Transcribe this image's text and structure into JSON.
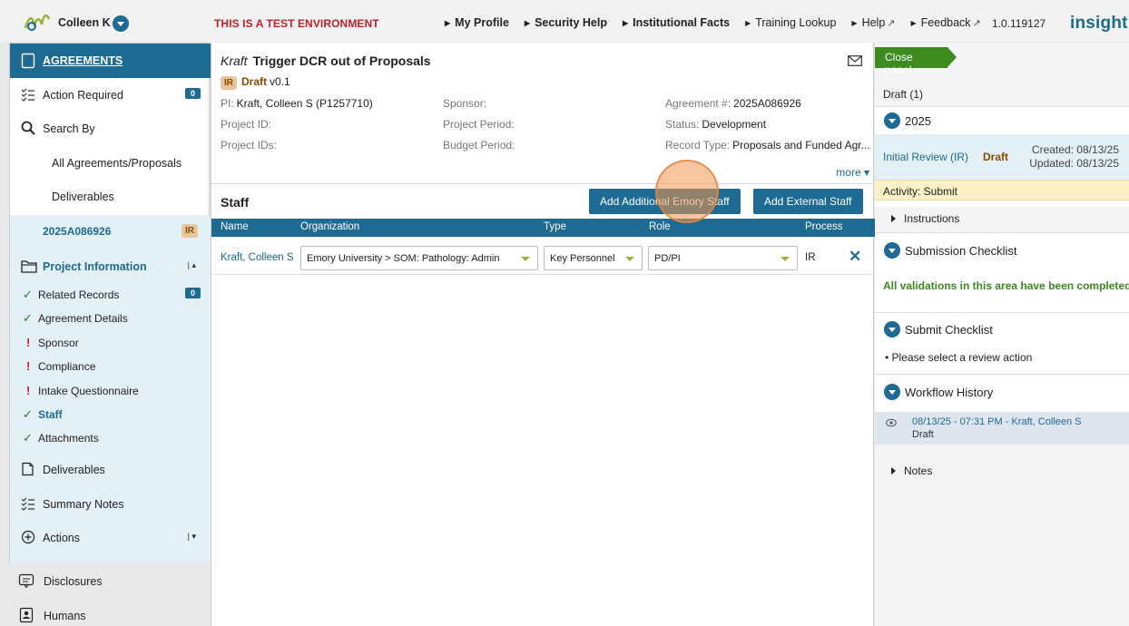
{
  "topbar": {
    "user_name": "Colleen K",
    "test_env": "THIS IS A TEST ENVIRONMENT",
    "nav": [
      {
        "label": "My Profile",
        "bold": true
      },
      {
        "label": "Security Help",
        "bold": true
      },
      {
        "label": "Institutional Facts",
        "bold": true
      },
      {
        "label": "Training Lookup",
        "bold": false
      },
      {
        "label": "Help",
        "bold": false
      },
      {
        "label": "Feedback",
        "bold": false
      }
    ],
    "version": "1.0.119127",
    "brand": "insight"
  },
  "leftnav": {
    "agreements": "AGREEMENTS",
    "action_required": "Action Required",
    "action_required_count": "0",
    "search_by": "Search By",
    "all_agreements": "All Agreements/Proposals",
    "deliverables": "Deliverables",
    "record_id": "2025A086926",
    "record_badge": "IR",
    "project_information": "Project Information",
    "project_info_caret": "| ▴",
    "sections": [
      {
        "label": "Related Records",
        "status": "ok",
        "badge": "0"
      },
      {
        "label": "Agreement Details",
        "status": "ok"
      },
      {
        "label": "Sponsor",
        "status": "bad"
      },
      {
        "label": "Compliance",
        "status": "bad"
      },
      {
        "label": "Intake Questionnaire",
        "status": "bad"
      },
      {
        "label": "Staff",
        "status": "ok",
        "active": true
      },
      {
        "label": "Attachments",
        "status": "ok"
      }
    ],
    "deliverables2": "Deliverables",
    "summary_notes": "Summary Notes",
    "actions": "Actions",
    "actions_caret": "| ▾",
    "disclosures": "Disclosures",
    "humans": "Humans"
  },
  "main": {
    "title_italic": "Kraft",
    "title": "Trigger DCR out of Proposals",
    "status_badge": "IR",
    "status_text": "Draft",
    "version": "v0.1",
    "fields": {
      "pi_k": "PI:",
      "pi_v": "Kraft, Colleen S (P1257710)",
      "sponsor_k": "Sponsor:",
      "sponsor_v": "",
      "agreement_k": "Agreement #:",
      "agreement_v": "2025A086926",
      "projid_k": "Project ID:",
      "projid_v": "",
      "period_k": "Project Period:",
      "period_v": "",
      "status_k": "Status:",
      "status_v": "Development",
      "projids_k": "Project IDs:",
      "projids_v": "",
      "budget_k": "Budget Period:",
      "budget_v": "",
      "rectype_k": "Record Type:",
      "rectype_v": "Proposals and Funded Agr..."
    },
    "more": "more ▾",
    "staff_title": "Staff",
    "btn_add_emory": "Add Additional Emory Staff",
    "btn_add_external": "Add External Staff",
    "columns": [
      "Name",
      "Organization",
      "Type",
      "Role",
      "Process"
    ],
    "row": {
      "name": "Kraft, Colleen S",
      "organization": "Emory University > SOM: Pathology: Admin",
      "type": "Key Personnel",
      "role": "PD/PI",
      "process": "IR",
      "remove": "✕"
    }
  },
  "right": {
    "close_panel": "Close panel",
    "draft_count": "Draft (1)",
    "year": "2025",
    "review_link": "Initial Review (IR)",
    "review_status": "Draft",
    "created": "Created: 08/13/25",
    "updated": "Updated: 08/13/25",
    "activity": "Activity:  Submit",
    "instructions": "Instructions",
    "submission_checklist": "Submission Checklist",
    "validations": "All validations in this area have been completed",
    "submit_checklist": "Submit Checklist",
    "submit_item": "Please select a review action",
    "workflow_history": "Workflow History",
    "history_entry": "08/13/25 - 07:31 PM",
    "history_user": "Kraft, Colleen S",
    "history_sep": " - ",
    "history_status": "Draft",
    "notes": "Notes"
  },
  "colors": {
    "primary": "#1d6a92",
    "success": "#3d8b1f",
    "danger": "#c0202a",
    "badge_ir": "#e9c59a"
  }
}
